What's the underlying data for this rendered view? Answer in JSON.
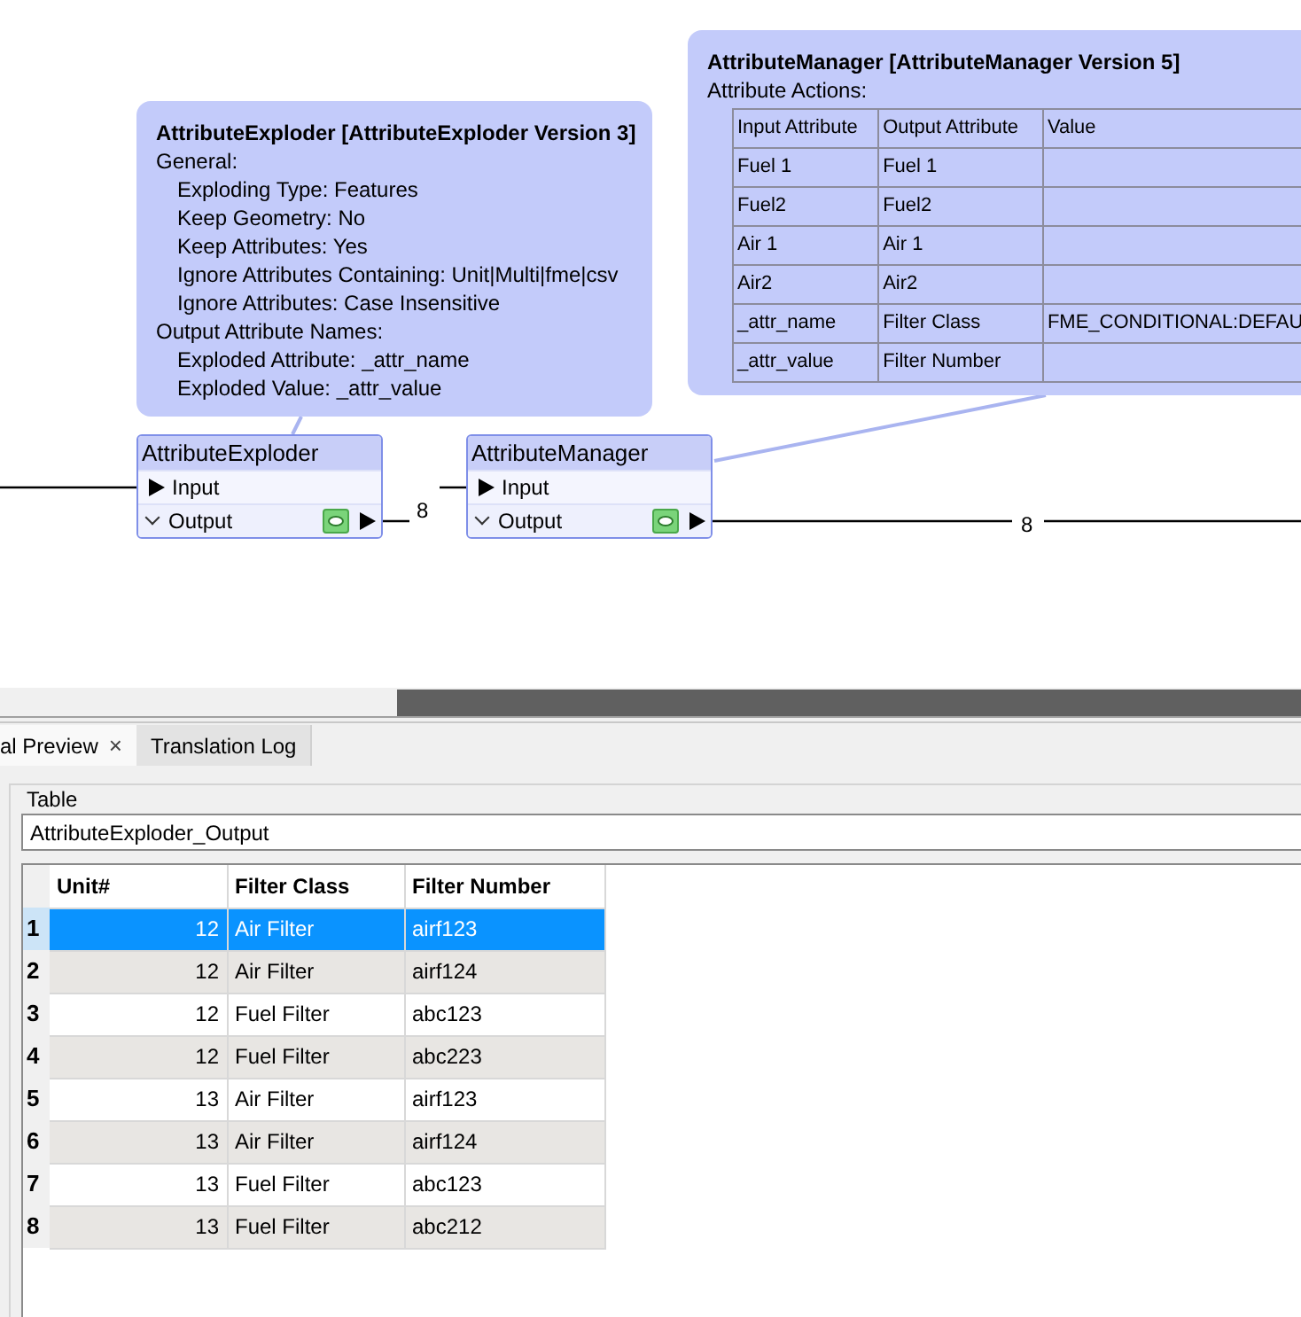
{
  "canvas": {
    "annotations": [
      {
        "title": "AttributeExploder [AttributeExploder Version 3]",
        "lines": [
          {
            "text": "General:",
            "kind": "section"
          },
          {
            "text": "Exploding Type: Features",
            "kind": "parameter"
          },
          {
            "text": "Keep Geometry: No",
            "kind": "parameter"
          },
          {
            "text": "Keep Attributes: Yes",
            "kind": "parameter"
          },
          {
            "text": "Ignore Attributes Containing: Unit|Multi|fme|csv",
            "kind": "parameter"
          },
          {
            "text": "Ignore Attributes: Case Insensitive",
            "kind": "parameter"
          },
          {
            "text": "Output Attribute Names:",
            "kind": "section"
          },
          {
            "text": "Exploded Attribute: _attr_name",
            "kind": "parameter"
          },
          {
            "text": "Exploded Value: _attr_value",
            "kind": "parameter"
          }
        ]
      },
      {
        "title": "AttributeManager [AttributeManager Version 5]",
        "lines": [
          {
            "text": "Attribute Actions:",
            "kind": "section"
          }
        ],
        "table": {
          "columns": [
            "Input Attribute",
            "Output Attribute",
            "Value"
          ],
          "rows": [
            [
              "Fuel 1",
              "Fuel 1"
            ],
            [
              "Fuel2",
              "Fuel2"
            ],
            [
              "Air 1",
              "Air 1"
            ],
            [
              "Air2",
              "Air2"
            ],
            [
              "_attr_name",
              "Filter Class",
              "FME_CONDITIONAL:DEFAU"
            ],
            [
              "_attr_value",
              "Filter Number"
            ]
          ]
        }
      }
    ],
    "nodes": [
      {
        "name": "AttributeExploder",
        "ports": [
          {
            "label": "Input",
            "kind": "input"
          },
          {
            "label": "Output",
            "kind": "output"
          }
        ]
      },
      {
        "name": "AttributeManager",
        "ports": [
          {
            "label": "Input",
            "kind": "input"
          },
          {
            "label": "Output",
            "kind": "output"
          }
        ]
      }
    ],
    "connections": [
      {
        "count": "8"
      },
      {
        "count": "8"
      }
    ]
  },
  "preview": {
    "tabs": [
      {
        "label": "al Preview",
        "selected": true,
        "close": "×"
      },
      {
        "label": "Translation Log",
        "selected": false
      }
    ],
    "group_label": "Table",
    "feature_type": "AttributeExploder_Output",
    "table": {
      "columns": [
        "Unit#",
        "Filter Class",
        "Filter Number"
      ],
      "rows": [
        {
          "number": "1",
          "cells": [
            "12",
            "Air Filter",
            "airf123"
          ],
          "selected": true
        },
        {
          "number": "2",
          "cells": [
            "12",
            "Air Filter",
            "airf124"
          ],
          "selected": false
        },
        {
          "number": "3",
          "cells": [
            "12",
            "Fuel Filter",
            "abc123"
          ],
          "selected": false
        },
        {
          "number": "4",
          "cells": [
            "12",
            "Fuel Filter",
            "abc223"
          ],
          "selected": false
        },
        {
          "number": "5",
          "cells": [
            "13",
            "Air Filter",
            "airf123"
          ],
          "selected": false
        },
        {
          "number": "6",
          "cells": [
            "13",
            "Air Filter",
            "airf124"
          ],
          "selected": false
        },
        {
          "number": "7",
          "cells": [
            "13",
            "Fuel Filter",
            "abc123"
          ],
          "selected": false
        },
        {
          "number": "8",
          "cells": [
            "13",
            "Fuel Filter",
            "abc212"
          ],
          "selected": false
        }
      ]
    }
  }
}
